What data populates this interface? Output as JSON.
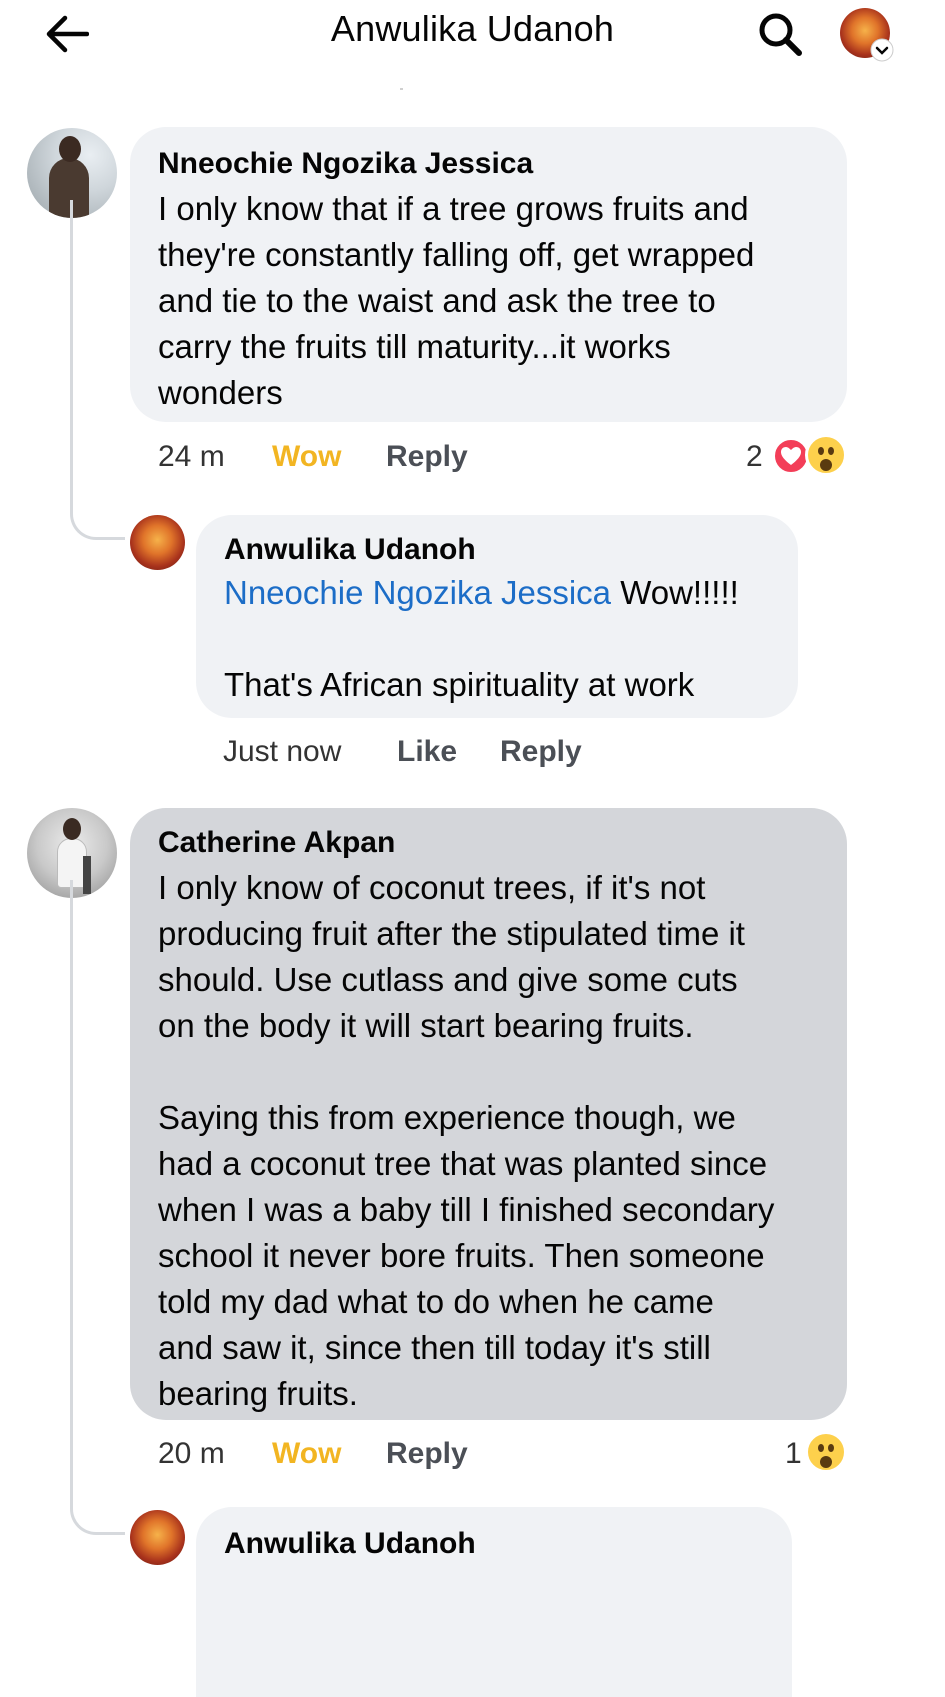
{
  "header": {
    "title": "Anwulika Udanoh",
    "back_icon": "arrow-left-icon",
    "search_icon": "search-icon",
    "profile_icon": "lion-avatar-icon"
  },
  "comments": [
    {
      "author": "Nneochie Ngozika Jessica",
      "lines": [
        "I only know that if a tree grows fruits and",
        "they're constantly falling off, get wrapped",
        "and tie to the waist and ask the tree to",
        "carry the fruits till maturity...it works",
        "wonders"
      ],
      "time": "24 m",
      "reaction_label": "Wow",
      "reply_label": "Reply",
      "reaction_count": "2",
      "reaction_icons": [
        "love",
        "wow"
      ],
      "reply": {
        "author": "Anwulika Udanoh",
        "mention": "Nneochie Ngozika Jessica",
        "line1_rest": " Wow!!!!!",
        "line2": "That's African spirituality at work",
        "time": "Just now",
        "like_label": "Like",
        "reply_label": "Reply"
      }
    },
    {
      "author": "Catherine Akpan",
      "lines": [
        "I only know of coconut trees, if it's not",
        "producing fruit after the stipulated time it",
        "should. Use cutlass and give some cuts",
        "on the body it will start bearing fruits.",
        "",
        "Saying this from experience though, we",
        "had a coconut tree that was planted since",
        "when I was a baby till I finished secondary",
        "school it never bore fruits. Then someone",
        "told my dad what to do when he came",
        "and saw it, since then till today it's still",
        "bearing fruits."
      ],
      "time": "20 m",
      "reaction_label": "Wow",
      "reply_label": "Reply",
      "reaction_count": "1",
      "reaction_icons": [
        "wow"
      ],
      "reply": {
        "author": "Anwulika Udanoh"
      }
    }
  ],
  "colors": {
    "wow": "#f2b522",
    "mention": "#1c6dc7",
    "bubble": "#f0f2f5",
    "bubble_selected": "#d4d6da",
    "love": "#f33e58"
  }
}
